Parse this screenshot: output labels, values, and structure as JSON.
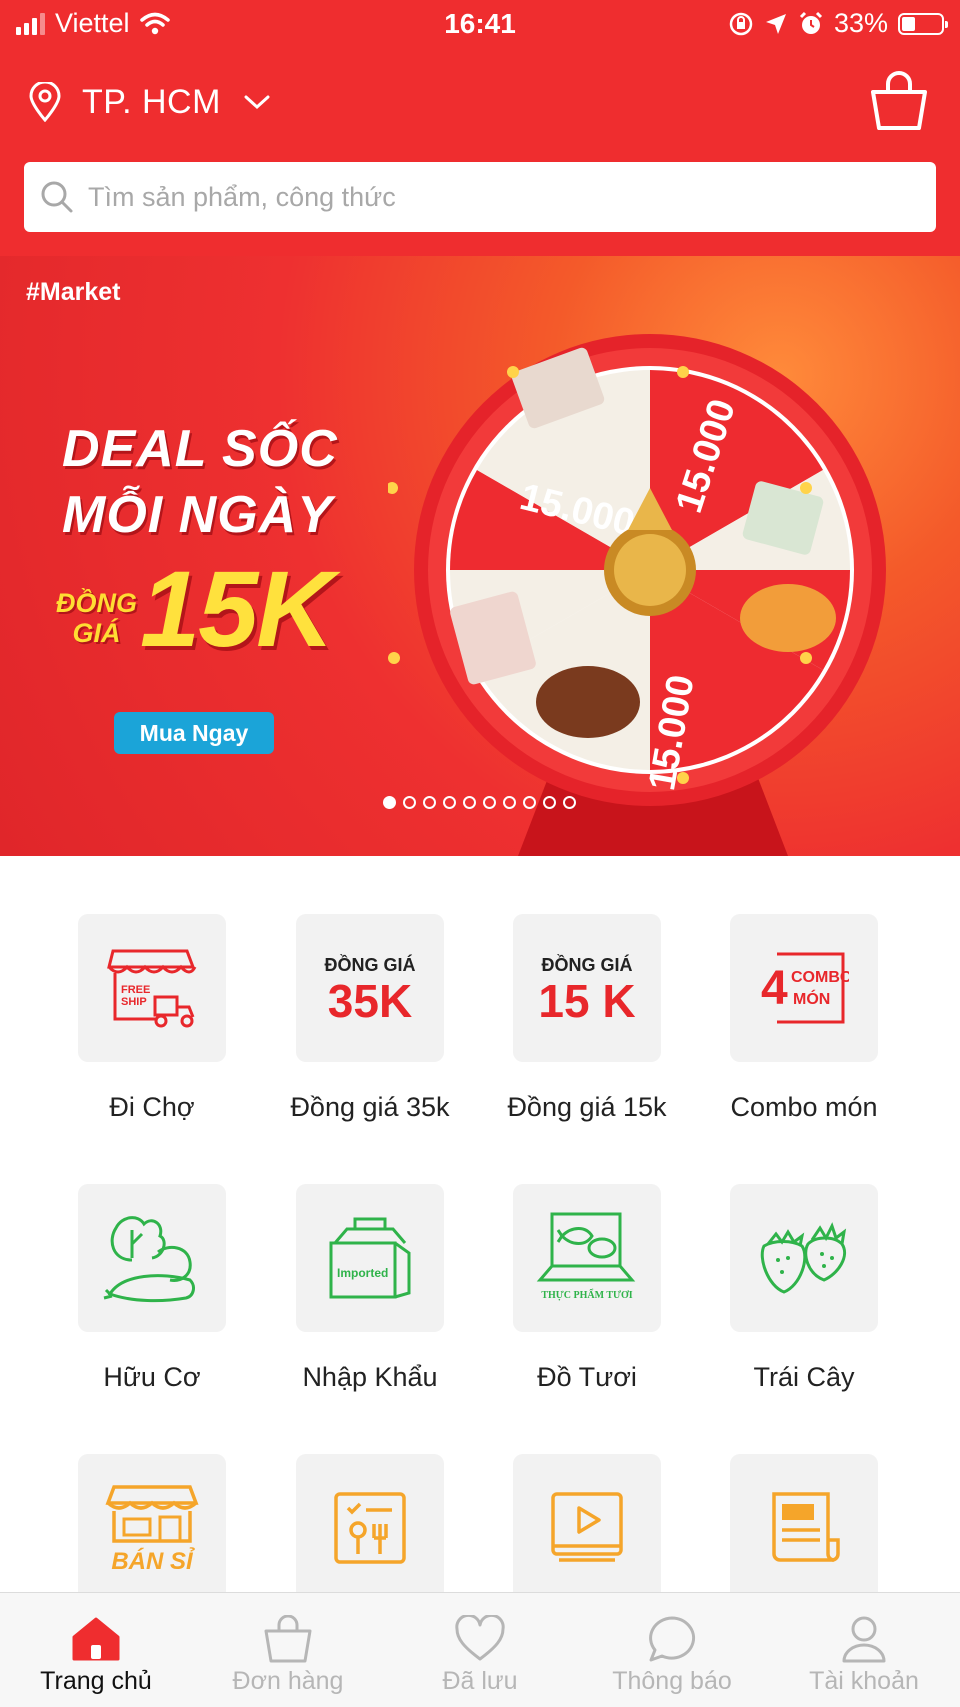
{
  "status_bar": {
    "carrier": "Viettel",
    "time": "16:41",
    "battery": "33%",
    "battery_level": 0.33
  },
  "header": {
    "location": "TP. HCM",
    "search_placeholder": "Tìm sản phẩm, công thức"
  },
  "banner": {
    "hashtag": "#Market",
    "headline_1": "DEAL SỐC",
    "headline_2": "MỖI NGÀY",
    "dong_1": "ĐỒNG",
    "dong_2": "GIÁ",
    "price": "15K",
    "cta": "Mua Ngay",
    "wheel_price_1": "15.000",
    "wheel_price_2": "15.000",
    "wheel_price_3": "15.000",
    "slide_count": 10,
    "active_slide": 1
  },
  "categories": [
    {
      "label": "Đi Chợ",
      "icon": "free-ship-store-icon",
      "icon_text_1": "FREE",
      "icon_text_2": "SHIP"
    },
    {
      "label": "Đồng giá 35k",
      "icon": "same-price-35k-icon",
      "icon_text_1": "ĐỒNG GIÁ",
      "icon_text_2": "35K"
    },
    {
      "label": "Đồng giá 15k",
      "icon": "same-price-15k-icon",
      "icon_text_1": "ĐỒNG GIÁ",
      "icon_text_2": "15 K"
    },
    {
      "label": "Combo món",
      "icon": "combo-icon",
      "icon_text_1": "4",
      "icon_text_2": "COMBO",
      "icon_text_3": "MÓN"
    },
    {
      "label": "Hữu Cơ",
      "icon": "vegetables-icon"
    },
    {
      "label": "Nhập Khẩu",
      "icon": "imported-box-icon",
      "icon_text_1": "Imported"
    },
    {
      "label": "Đồ Tươi",
      "icon": "fresh-food-icon",
      "icon_text_1": "THỰC PHẨM TƯƠI"
    },
    {
      "label": "Trái Cây",
      "icon": "strawberry-icon"
    },
    {
      "label": "",
      "icon": "wholesale-store-icon",
      "icon_text_1": "BÁN SỈ"
    },
    {
      "label": "",
      "icon": "recipe-menu-icon"
    },
    {
      "label": "",
      "icon": "video-play-icon"
    },
    {
      "label": "",
      "icon": "news-icon"
    }
  ],
  "bottom_nav": [
    {
      "label": "Trang chủ",
      "icon": "home-icon",
      "active": true
    },
    {
      "label": "Đơn hàng",
      "icon": "shopping-bag-icon",
      "active": false
    },
    {
      "label": "Đã lưu",
      "icon": "heart-icon",
      "active": false
    },
    {
      "label": "Thông báo",
      "icon": "chat-bubble-icon",
      "active": false
    },
    {
      "label": "Tài khoản",
      "icon": "user-icon",
      "active": false
    }
  ],
  "colors": {
    "brand_red": "#ef2d2f",
    "category_red": "#e8272b",
    "category_green": "#2fb34a",
    "category_orange": "#f5a52a",
    "nav_inactive": "#b6b6b6"
  }
}
